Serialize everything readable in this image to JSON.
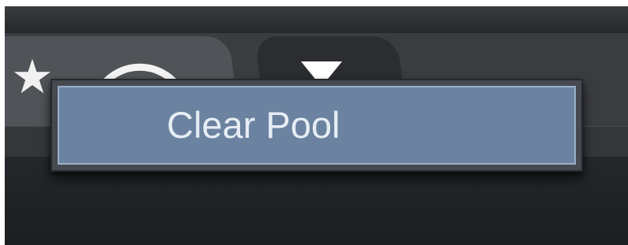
{
  "toolbar": {
    "icons": [
      "star-icon",
      "wifi-icon",
      "triangle-down-icon"
    ]
  },
  "context_menu": {
    "items": [
      {
        "label": "Clear Pool",
        "highlighted": true
      }
    ]
  },
  "colors": {
    "menu_highlight": "#6b82a0",
    "menu_highlight_border": "#9bb0c8",
    "menu_background": "#464a50",
    "menu_text": "#e6edf4"
  }
}
